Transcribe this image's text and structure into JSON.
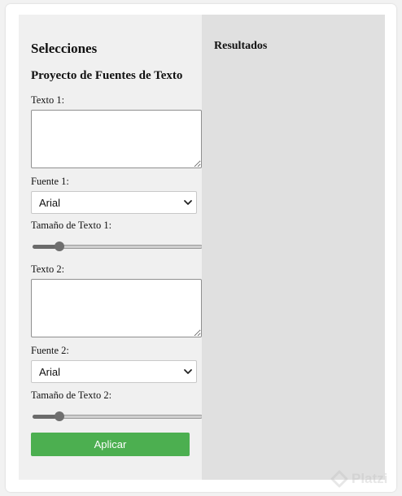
{
  "selecciones": {
    "title": "Selecciones",
    "subtitle": "Proyecto de Fuentes de Texto",
    "text1_label": "Texto 1:",
    "text1_value": "",
    "font1_label": "Fuente 1:",
    "font1_value": "Arial",
    "size1_label": "Tamaño de Texto 1:",
    "size1_level": 0.16,
    "text2_label": "Texto 2:",
    "text2_value": "",
    "font2_label": "Fuente 2:",
    "font2_value": "Arial",
    "size2_label": "Tamaño de Texto 2:",
    "size2_level": 0.16,
    "apply_label": "Aplicar"
  },
  "resultados": {
    "title": "Resultados"
  },
  "watermark": {
    "text": "Platzi",
    "icon": "platzi-logo"
  },
  "colors": {
    "left_panel": "#f0f0f0",
    "right_panel": "#e0e0e0",
    "apply_button": "#4caf50"
  }
}
